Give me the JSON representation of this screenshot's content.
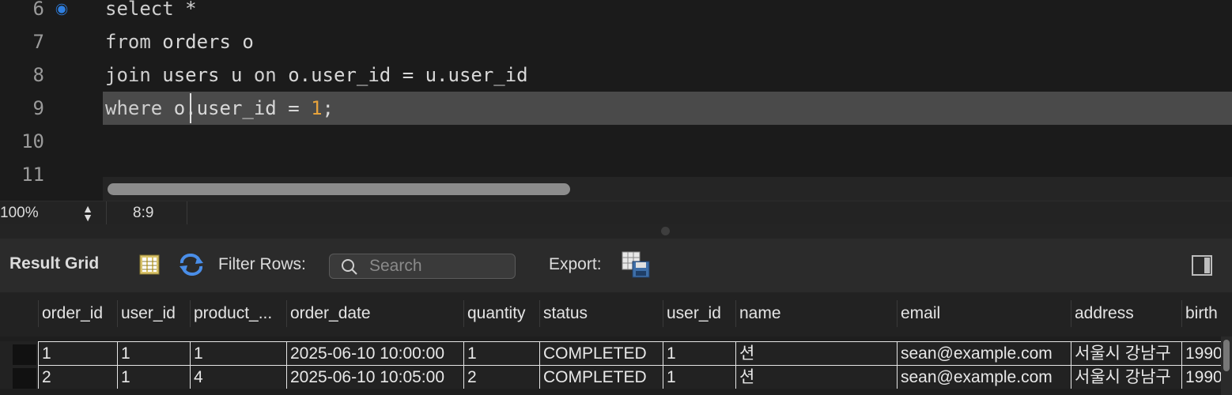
{
  "editor": {
    "lines": [
      {
        "n": "6",
        "parts": [
          {
            "t": "select *",
            "c": "kw"
          }
        ]
      },
      {
        "n": "7",
        "parts": [
          {
            "t": "from",
            "c": "kw"
          },
          {
            "t": " orders o",
            "c": ""
          }
        ]
      },
      {
        "n": "8",
        "parts": [
          {
            "t": "join",
            "c": "kw"
          },
          {
            "t": " users u ",
            "c": ""
          },
          {
            "t": "on",
            "c": "kw"
          },
          {
            "t": " o.user_id = u.user_id",
            "c": ""
          }
        ]
      },
      {
        "n": "9",
        "parts": [
          {
            "t": "where",
            "c": "kw"
          },
          {
            "t": " o.user_id = ",
            "c": ""
          },
          {
            "t": "1",
            "c": "num"
          },
          {
            "t": ";",
            "c": ""
          }
        ]
      },
      {
        "n": "10",
        "parts": []
      },
      {
        "n": "11",
        "parts": []
      }
    ]
  },
  "status": {
    "zoom": "100%",
    "cursor": "8:9"
  },
  "toolbar": {
    "result_grid": "Result Grid",
    "filter_rows": "Filter Rows:",
    "search_placeholder": "Search",
    "export": "Export:"
  },
  "grid": {
    "columns": [
      "order_id",
      "user_id",
      "product_...",
      "order_date",
      "quantity",
      "status",
      "user_id",
      "name",
      "email",
      "address",
      "birth"
    ],
    "rows": [
      [
        "1",
        "1",
        "1",
        "2025-06-10 10:00:00",
        "1",
        "COMPLETED",
        "1",
        "션",
        "sean@example.com",
        "서울시 강남구",
        "1990"
      ],
      [
        "2",
        "1",
        "4",
        "2025-06-10 10:05:00",
        "2",
        "COMPLETED",
        "1",
        "션",
        "sean@example.com",
        "서울시 강남구",
        "1990"
      ]
    ]
  },
  "colors": {
    "accent": "#2f7fe0",
    "number": "#e6a23c",
    "highlight": "#4a4a4a"
  }
}
